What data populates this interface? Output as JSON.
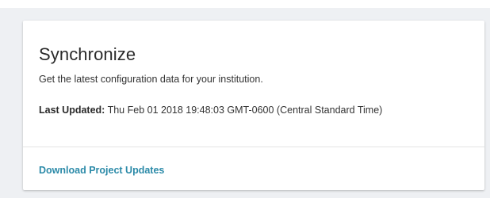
{
  "card": {
    "title": "Synchronize",
    "subtitle": "Get the latest configuration data for your institution.",
    "last_updated_label": "Last Updated:",
    "last_updated_value": "Thu Feb 01 2018 19:48:03 GMT-0600 (Central Standard Time)",
    "action_label": "Download Project Updates"
  },
  "colors": {
    "background": "#eef0f3",
    "card": "#ffffff",
    "link": "#2b8aa8",
    "divider": "#e3e3e3"
  }
}
